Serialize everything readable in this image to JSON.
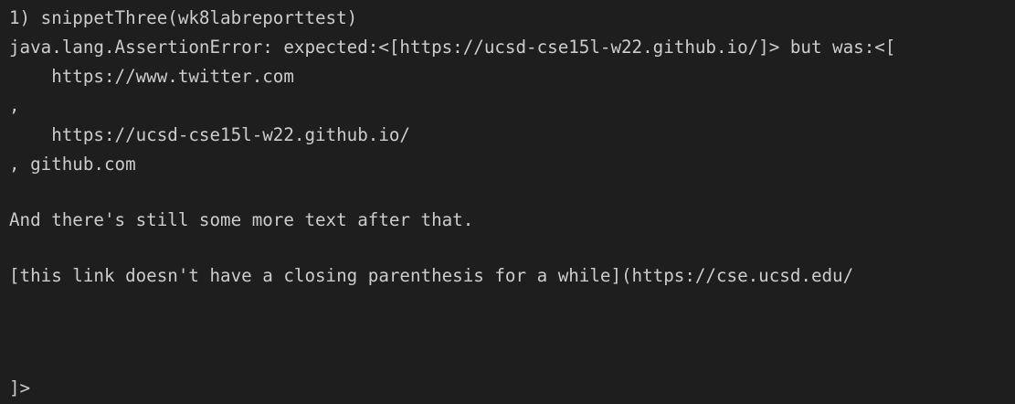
{
  "terminal": {
    "lines": [
      "1) snippetThree(wk8labreporttest)",
      "java.lang.AssertionError: expected:<[https://ucsd-cse15l-w22.github.io/]> but was:<[",
      "    https://www.twitter.com",
      ",",
      "    https://ucsd-cse15l-w22.github.io/",
      ", github.com",
      "And there's still some more text after that.",
      "[this link doesn't have a closing parenthesis for a while](https://cse.ucsd.edu/",
      "]>"
    ]
  }
}
